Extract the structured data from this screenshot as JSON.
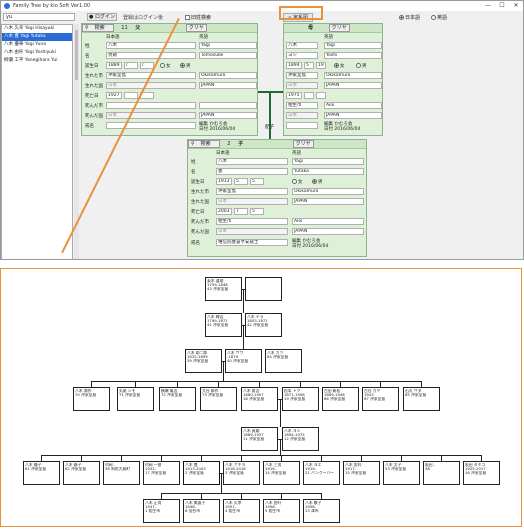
{
  "window": {
    "title": "Family Tree by kio Soft Ver1.00",
    "controls": [
      "—",
      "☐",
      "✕"
    ]
  },
  "toolbar": {
    "search_value": "yu",
    "login_label": "ログイン",
    "login_message": "登録はログイン後",
    "old_search_label": "旧姓検索",
    "family_tree_label": "家系図",
    "lang_ja": "日本語",
    "lang_en": "英語"
  },
  "sidebar": {
    "items": [
      "八木 久幸 Yagi Hisayuki",
      "八木 豊 Yagi Yutaka",
      "八木 優華 Yagi Yuna",
      "八木 由吁 Yagi Yoshiyuki",
      "柳瀬 工平 Yanegihara Yui"
    ],
    "selected": 1
  },
  "father": {
    "search_label": "検索",
    "id": "11",
    "relation": "父",
    "clear_label": "クリヤ",
    "id2": "13",
    "col_ja": "日本語",
    "col_en": "英語",
    "surname_label": "姓",
    "surname_ja": "八木",
    "surname_en": "Yagi",
    "given_label": "名",
    "given_ja": "貞勛",
    "given_en": "Tomosuke",
    "birth_label": "誕生日",
    "birth_year": "1889",
    "birth_m": "/",
    "birth_d": "/",
    "female_label": "女",
    "male_label": "男",
    "birth_city_label": "生れた市",
    "birth_city_ja": "沖家室島",
    "birth_city_en": "Okikamuro",
    "birth_country_label": "生れた国",
    "birth_country_ja": "日本",
    "birth_country_en": "JAPAN",
    "death_label": "死亡日",
    "death_year": "1927",
    "death_city_label": "死んだ市",
    "death_city_en": "",
    "death_country_label": "死んだ国",
    "death_country_ja": "日本",
    "death_country_en": "JAPAN",
    "posthumous_label": "戒名",
    "edit_label": "編集 かむろ会",
    "edit_date": "日付 2016/06/04"
  },
  "mother": {
    "search_label": "検索",
    "id": "13",
    "relation": "母",
    "clear_label": "クリヤ",
    "surname_ja": "八木",
    "surname_en": "Yagi",
    "given_ja": "ヨシ",
    "given_en": "Yoshi",
    "birth_year": "1894",
    "birth_m": "5",
    "birth_d": "19",
    "birth_city_ja": "沖家室島",
    "birth_city_en": "Okikamuro",
    "birth_country_ja": "日本",
    "birth_country_en": "JAPAN",
    "death_year": "1975",
    "death_city_ja": "相生市",
    "death_city_en": "Aioi",
    "death_country_ja": "日本",
    "death_country_en": "JAPAN",
    "edit_label": "編集 かむろ会",
    "edit_date": "日付 2016/06/04"
  },
  "child": {
    "search_label": "検索",
    "id": "2",
    "relation": "子",
    "clear_label": "クリヤ",
    "col_ja": "日本語",
    "col_en": "英語",
    "surname_ja": "八木",
    "surname_en": "Yagi",
    "given_ja": "豊",
    "given_en": "Yutaka",
    "birth_year": "1913",
    "birth_m": "5",
    "birth_d": "5",
    "birth_city_ja": "沖家室島",
    "birth_city_en": "Okikamuro",
    "birth_country_ja": "日本",
    "birth_country_en": "JAPAN",
    "death_year": "2003",
    "death_m": "7",
    "death_d": "5",
    "death_city_ja": "相生市",
    "death_city_en": "Aioi",
    "death_country_ja": "日本",
    "death_country_en": "JAPAN",
    "posthumous_ja": "唯信院豊誉亨安居士",
    "edit_label": "編集 かむろ会",
    "edit_date": "日付 2016/06/04"
  },
  "spouse_label": "配子",
  "tree": {
    "nodes": [
      [
        "東木 道助",
        "1759-1848",
        "43 沖家室島"
      ],
      [
        "",
        "",
        ""
      ],
      [
        "八木 梅吉",
        "1799-1871",
        "41 沖家室島"
      ],
      [
        "八木 テラ",
        "1803-1871",
        "42 沖家室島"
      ],
      [
        "八木 助二郎",
        "1832-1899",
        "39 沖家室島"
      ],
      [
        "八木 サワ",
        "-1879",
        "40 沖家室島"
      ],
      [
        "八木 カツ",
        "",
        "84 沖家室島"
      ],
      [
        "八木 満作",
        "",
        "70 沖家室島"
      ],
      [
        "丸尾 シモ",
        "",
        "71 沖家室島"
      ],
      [
        "横瀬 亀吉",
        "",
        "72 沖家室島"
      ],
      [
        "大谷 節作",
        "",
        "73 沖家室島"
      ],
      [
        "八木 庸吉",
        "1860-1907",
        "18 沖家室島"
      ],
      [
        "松本 トク",
        "1871-1958",
        "19 沖家室島"
      ],
      [
        "古田 新松",
        "1869-1946",
        "66 沖家室島"
      ],
      [
        "古谷 カヤ",
        "1943",
        "67 沖家室島"
      ],
      [
        "石丸 サダ",
        "",
        "65 沖家室島"
      ],
      [
        "八木 貞勛",
        "1889-1927",
        "11 沖家室島"
      ],
      [
        "八木 ヨシ",
        "1894-1975",
        "12 沖家室島"
      ],
      [
        "八木 種子",
        "",
        "61 沖家室島"
      ],
      [
        "八木 静子",
        "",
        "62 沖家室島"
      ],
      [
        "村岡 -",
        "",
        "36 周防大島町"
      ],
      [
        "村岡 一誉",
        "1931-",
        "17 沖家室島"
      ],
      [
        "八木 豊",
        "1913-2003",
        "2 沖家室島"
      ],
      [
        "八木 アキヨ",
        "1918-2016",
        "3 沖家室島"
      ],
      [
        "八木 三男",
        "1916-",
        "14 沖家室島"
      ],
      [
        "八木 ヨエ",
        "1919-",
        "21 バンクーバー"
      ],
      [
        "八木 忠利",
        "1917-",
        "15 沖家室島"
      ],
      [
        "八木 文子",
        "",
        "53 沖家室島"
      ],
      [
        "阪田 -",
        "",
        "38"
      ],
      [
        "阪田 タミコ",
        "1925-2017",
        "16 沖家室島"
      ],
      [
        "八木 正尚",
        "1947-",
        "1 相生市"
      ],
      [
        "八木 美喜子",
        "1948-",
        "6 仙台市"
      ],
      [
        "八木 久幸",
        "1951-",
        "4 相生市"
      ],
      [
        "八木 由吁",
        "1956-",
        "5 相生市"
      ],
      [
        "八木 敬子",
        "1958-",
        "13 津市"
      ]
    ]
  }
}
